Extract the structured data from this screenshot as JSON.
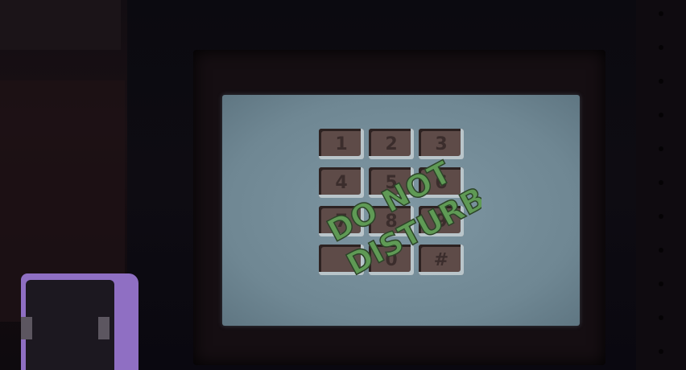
{
  "keypad": {
    "keys": [
      "1",
      "2",
      "3",
      "4",
      "5",
      "6",
      "7",
      "8",
      "9",
      "",
      "0",
      "#"
    ]
  },
  "overlay": {
    "line1": "DO NOT",
    "line2": "DISTURB",
    "color": "#5f9a55"
  },
  "colors": {
    "screen": "#7f97a3",
    "key_face": "#5e4b48",
    "device": "#8f6fc3"
  }
}
